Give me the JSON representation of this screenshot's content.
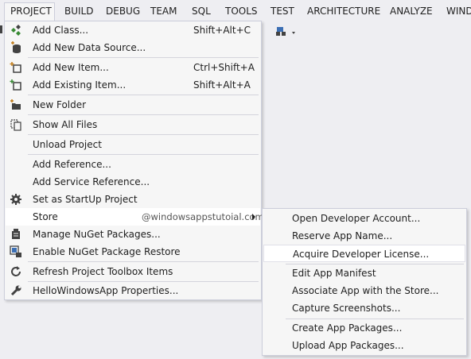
{
  "menubar": {
    "items": [
      "PROJECT",
      "BUILD",
      "DEBUG",
      "TEAM",
      "SQL",
      "TOOLS",
      "TEST",
      "ARCHITECTURE",
      "ANALYZE",
      "WIND"
    ]
  },
  "project_menu": {
    "items": [
      {
        "label": "Add Class...",
        "shortcut": "Shift+Alt+C",
        "icon": "add-class-icon"
      },
      {
        "label": "Add New Data Source...",
        "icon": "add-data-source-icon"
      },
      {
        "label": "Add New Item...",
        "shortcut": "Ctrl+Shift+A",
        "icon": "add-new-item-icon"
      },
      {
        "label": "Add Existing Item...",
        "shortcut": "Shift+Alt+A",
        "icon": "add-existing-item-icon"
      },
      {
        "label": "New Folder",
        "icon": "new-folder-icon"
      },
      {
        "label": "Show All Files",
        "icon": "show-all-files-icon"
      },
      {
        "label": "Unload Project"
      },
      {
        "label": "Add Reference..."
      },
      {
        "label": "Add Service Reference..."
      },
      {
        "label": "Set as StartUp Project",
        "icon": "gear-icon"
      },
      {
        "label": "Store",
        "watermark": "@windowsappstutoial.com"
      },
      {
        "label": "Manage NuGet Packages...",
        "icon": "nuget-icon"
      },
      {
        "label": "Enable NuGet Package Restore",
        "icon": "package-restore-icon"
      },
      {
        "label": "Refresh Project Toolbox Items",
        "icon": "refresh-icon"
      },
      {
        "label": "HelloWindowsApp Properties...",
        "icon": "wrench-icon"
      }
    ]
  },
  "store_submenu": {
    "items": [
      {
        "label": "Open Developer Account..."
      },
      {
        "label": "Reserve App Name..."
      },
      {
        "label": "Acquire Developer License..."
      },
      {
        "label": "Edit App Manifest"
      },
      {
        "label": "Associate App with the Store..."
      },
      {
        "label": "Capture Screenshots..."
      },
      {
        "label": "Create App Packages..."
      },
      {
        "label": "Upload App Packages..."
      }
    ]
  },
  "colors": {
    "menubar_bg": "#eeeef2",
    "menu_bg": "#f6f6f6",
    "menu_border": "#cccedb",
    "highlight": "#ffffff",
    "icon_green": "#388a34",
    "icon_dark": "#424242"
  }
}
